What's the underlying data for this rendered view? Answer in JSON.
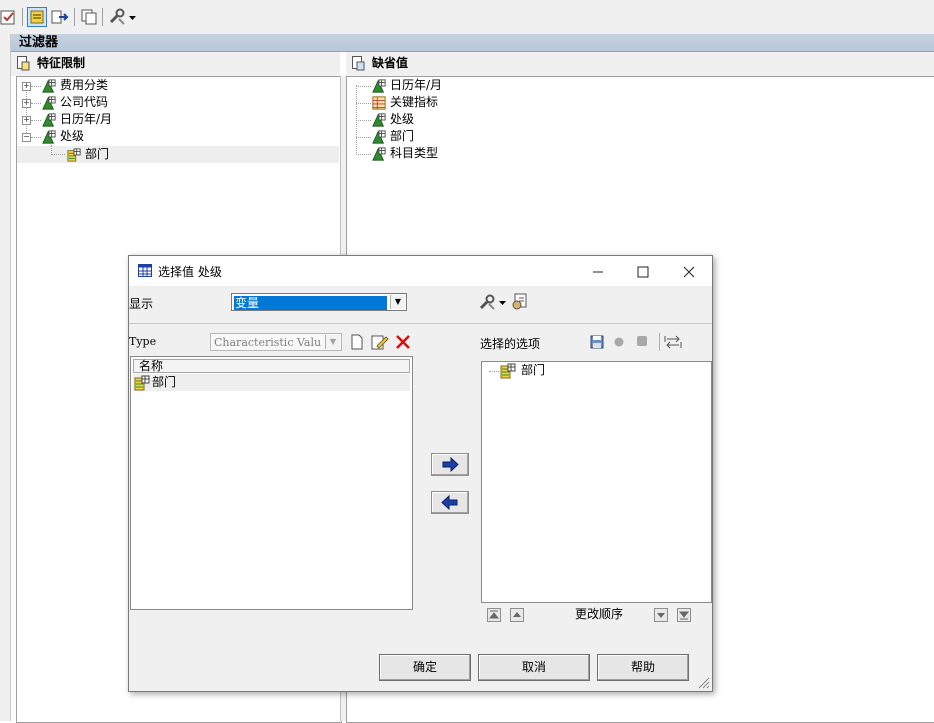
{
  "filter": {
    "header_title": "过滤器",
    "left_pane_title": "特征限制",
    "right_pane_title": "缺省值",
    "left_tree": [
      {
        "label": "费用分类",
        "expanded": false
      },
      {
        "label": "公司代码",
        "expanded": false
      },
      {
        "label": "日历年/月",
        "expanded": false
      },
      {
        "label": "处级",
        "expanded": true
      },
      {
        "label": "部门",
        "child": true
      }
    ],
    "right_tree": [
      {
        "label": "日历年/月",
        "icon": "characteristic-icon"
      },
      {
        "label": "关键指标",
        "icon": "key-figure-icon"
      },
      {
        "label": "处级",
        "icon": "characteristic-icon"
      },
      {
        "label": "部门",
        "icon": "characteristic-icon"
      },
      {
        "label": "科目类型",
        "icon": "characteristic-icon"
      }
    ]
  },
  "dialog": {
    "title": "选择值 处级",
    "display_label": "显示",
    "display_value": "变量",
    "type_label": "Type",
    "type_value": "Characteristic Valu",
    "name_column": "名称",
    "available_items": [
      "部门"
    ],
    "selected_label": "选择的选项",
    "selected_items": [
      "部门"
    ],
    "reorder_label": "更改顺序",
    "ok_label": "确定",
    "cancel_label": "取消",
    "help_label": "帮助"
  },
  "colors": {
    "selection_blue": "#0078d7",
    "header_blue": "#c6d3e2",
    "icon_green": "#2e8b2e",
    "delete_red": "#d01010",
    "arrow_blue": "#1c3fa8"
  }
}
